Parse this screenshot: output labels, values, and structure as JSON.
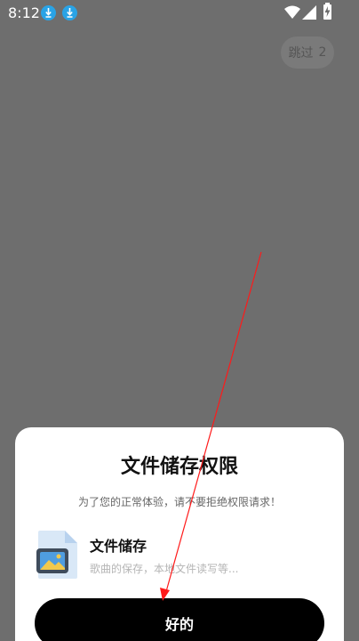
{
  "status_bar": {
    "time": "8:12",
    "download_icon": "download-circle-icon",
    "wifi_icon": "wifi-icon",
    "signal_icon": "signal-icon",
    "battery_icon": "battery-charging-icon"
  },
  "skip": {
    "label": "跳过",
    "countdown": "2"
  },
  "dialog": {
    "title": "文件储存权限",
    "subtitle": "为了您的正常体验，请不要拒绝权限请求！",
    "permission": {
      "icon": "image-file-icon",
      "title": "文件储存",
      "description": "歌曲的保存，本地文件读写等..."
    },
    "ok_label": "好的"
  },
  "colors": {
    "overlay": "#6e6e6e",
    "accent_download": "#29a3e6",
    "button_bg": "#000000",
    "annotation_arrow": "#ff1a1a"
  }
}
